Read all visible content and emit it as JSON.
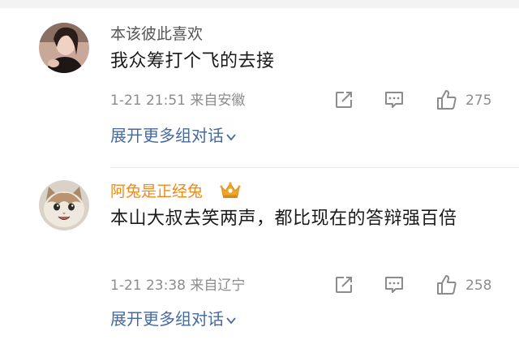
{
  "comments": [
    {
      "username": "本该彼此喜欢",
      "text": "我众筹打个飞的去接",
      "timestamp": "1-21 21:51",
      "location": "来自安徽",
      "meta_separator": " ",
      "likes": "275",
      "expand_label": "展开更多组对话",
      "avatar_icon": "user-photo-avatar"
    },
    {
      "username": "阿兔是正经兔",
      "text": "本山大叔去笑两声，都比现在的答辩强百倍",
      "timestamp": "1-21 23:38",
      "location": "来自辽宁",
      "meta_separator": " ",
      "likes": "258",
      "expand_label": "展开更多组对话",
      "avatar_icon": "cat-avatar",
      "badge_icon": "crown-badge-icon"
    }
  ],
  "colors": {
    "username": "#555555",
    "username_highlight": "#ef8a18",
    "link": "#476a9f",
    "meta": "#8c8c8c",
    "icon": "#8c8c8c"
  }
}
